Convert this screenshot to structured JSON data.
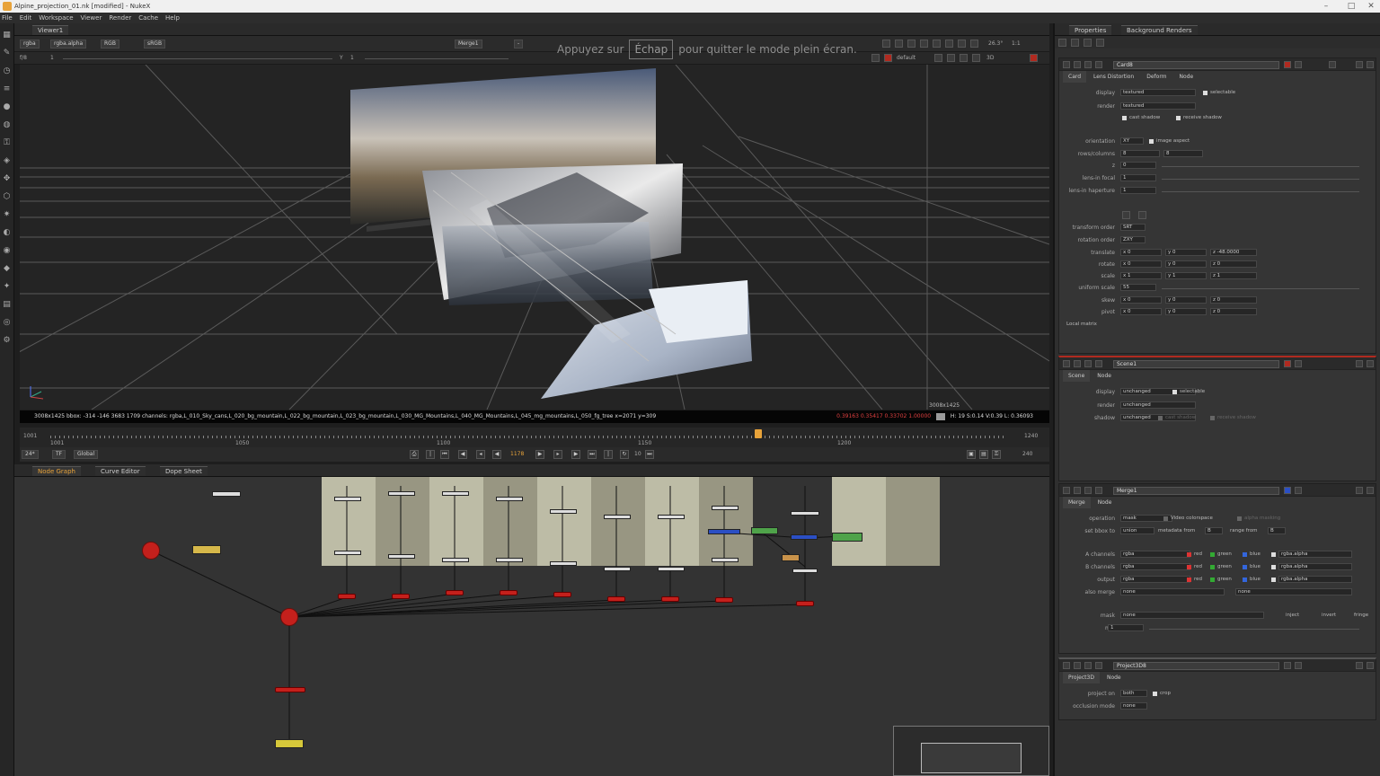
{
  "window": {
    "title": "Alpine_projection_01.nk [modified] - NukeX",
    "controls": [
      "–",
      "□",
      "✕"
    ]
  },
  "menu": [
    "File",
    "Edit",
    "Workspace",
    "Viewer",
    "Render",
    "Cache",
    "Help"
  ],
  "viewer": {
    "tab_label": "Viewer1",
    "channels": "rgba",
    "alpha": "rgba.alpha",
    "display": "RGB",
    "colorspace": "sRGB",
    "input_a": "Merge1",
    "input_b": "-",
    "zoom": "26.3°",
    "ratio": "1:1",
    "frame_f": "f/8",
    "gain": "1",
    "y_label": "Y",
    "gamma": "1",
    "lut": "default",
    "mode_3d": "3D",
    "resolution_label": "3008x1425",
    "info_text": "3008x1425  bbox: -314 -146 3683 1709 channels: rgba,L_010_Sky_cans,L_020_bg_mountain,L_022_bg_mountain,L_023_bg_mountain,L_030_MG_Mountains,L_040_MG_Mountains,L_045_mg_mountains,L_050_fg_tree  x=2071 y=309",
    "pixel_values": "0.39163  0.35417  0.33702  1.00000",
    "hsvl": "H: 19 S:0.14 V:0.39  L: 0.36093"
  },
  "fullscreen_msg": {
    "before": "Appuyez sur",
    "key": "Échap",
    "after": "pour quitter le mode plein écran."
  },
  "timeline": {
    "start": "1001",
    "end": "1240",
    "tick_labels": [
      "1001",
      "1050",
      "1100",
      "1150",
      "1200"
    ],
    "current_frame_marker": "1178",
    "fps": "24*",
    "tf": "TF",
    "range": "Global",
    "current_frame": "1178",
    "increment": "10",
    "end_frame": "240"
  },
  "node_graph": {
    "tabs": [
      "Node Graph",
      "Curve Editor",
      "Dope Sheet"
    ],
    "labels": {
      "camera": "Camera",
      "scene": "Scene1",
      "viewer": "Viewer1",
      "write": "ScanlineRender",
      "card_prefix": "Card"
    }
  },
  "properties": {
    "tabs": [
      "Properties",
      "Background Renders"
    ],
    "card_panel": {
      "name": "Card8",
      "subtabs": [
        "Card",
        "Lens Distortion",
        "Deform",
        "Node"
      ],
      "display_label": "display",
      "display_value": "textured",
      "selectable": "selectable",
      "render_label": "render",
      "render_value": "textured",
      "cast_shadow": "cast shadow",
      "receive_shadow": "receive shadow",
      "orientation_label": "orientation",
      "orientation_value": "XY",
      "image_aspect": "image aspect",
      "rows_label": "rows/columns",
      "rows_value": "8",
      "cols_value": "8",
      "z_label": "z",
      "z_value": "0",
      "focal_label": "lens-in focal",
      "focal_value": "1",
      "haperture_label": "lens-in haperture",
      "haperture_value": "1",
      "transform_order_label": "transform order",
      "transform_order_value": "SRT",
      "rotation_order_label": "rotation order",
      "rotation_order_value": "ZXY",
      "translate_label": "translate",
      "translate_x": "x 0",
      "translate_y": "y 0",
      "translate_z": "z -48.0000",
      "rotate_label": "rotate",
      "rotate_x": "x 0",
      "rotate_y": "y 0",
      "rotate_z": "z 0",
      "scale_label": "scale",
      "scale_x": "x 1",
      "scale_y": "y 1",
      "scale_z": "z 1",
      "uniform_label": "uniform scale",
      "uniform_value": "55",
      "skew_label": "skew",
      "skew_x": "x 0",
      "skew_y": "y 0",
      "skew_z": "z 0",
      "pivot_label": "pivot",
      "pivot_x": "x 0",
      "pivot_y": "y 0",
      "pivot_z": "z 0",
      "local_matrix": "Local matrix"
    },
    "scene_panel": {
      "name": "Scene1",
      "subtabs": [
        "Scene",
        "Node"
      ],
      "display_label": "display",
      "display_value": "unchanged",
      "selectable": "selectable",
      "render_label": "render",
      "render_value": "unchanged",
      "shadow_label": "shadow",
      "shadow_value": "unchanged",
      "cast_shadow": "cast shadow",
      "receive_shadow": "receive shadow"
    },
    "merge_panel": {
      "name": "Merge1",
      "subtabs": [
        "Merge",
        "Node"
      ],
      "operation_label": "operation",
      "operation_value": "mask",
      "video_colorspace": "Video colorspace",
      "alpha_masking": "alpha masking",
      "bbox_label": "set bbox to",
      "bbox_value": "union",
      "metadata_label": "metadata from",
      "metadata_value": "B",
      "range_label": "range from",
      "range_value": "B",
      "a_label": "A channels",
      "a_value": "rgba",
      "b_label": "B channels",
      "b_value": "rgba",
      "out_label": "output",
      "out_value": "rgba",
      "also_label": "also merge",
      "also_value": "none",
      "also_value2": "none",
      "c_red": "red",
      "c_green": "green",
      "c_blue": "blue",
      "c_alpha": "rgba.alpha",
      "mask_label": "mask",
      "mask_value": "none",
      "inject": "inject",
      "invert": "invert",
      "fringe": "fringe",
      "mix_label": "mix",
      "mix_value": "1"
    },
    "project_panel": {
      "name": "Project3D8",
      "subtabs": [
        "Project3D",
        "Node"
      ],
      "project_on_label": "project on",
      "project_on_value": "both",
      "crop": "crop",
      "occlusion_label": "occlusion mode",
      "occlusion_value": "none"
    }
  }
}
